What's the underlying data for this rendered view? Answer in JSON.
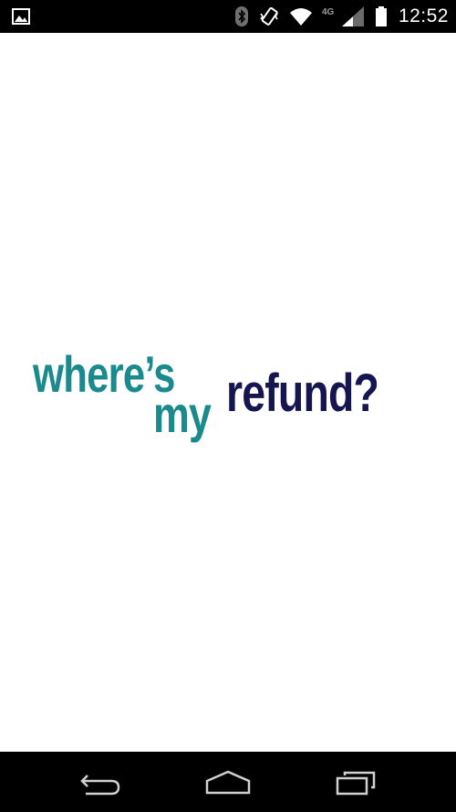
{
  "status_bar": {
    "time": "12:52",
    "network": "4G",
    "icons": [
      "image-notification-icon",
      "bluetooth-icon",
      "vibrate-icon",
      "wifi-icon",
      "cell-signal-icon",
      "battery-icon"
    ]
  },
  "logo": {
    "line1": "where’s",
    "line2": "my",
    "line3": "refund?",
    "colors": {
      "teal": "#1a8a8c",
      "navy": "#151650"
    }
  },
  "nav_bar": {
    "icons": [
      "back-icon",
      "home-icon",
      "recents-icon"
    ]
  }
}
